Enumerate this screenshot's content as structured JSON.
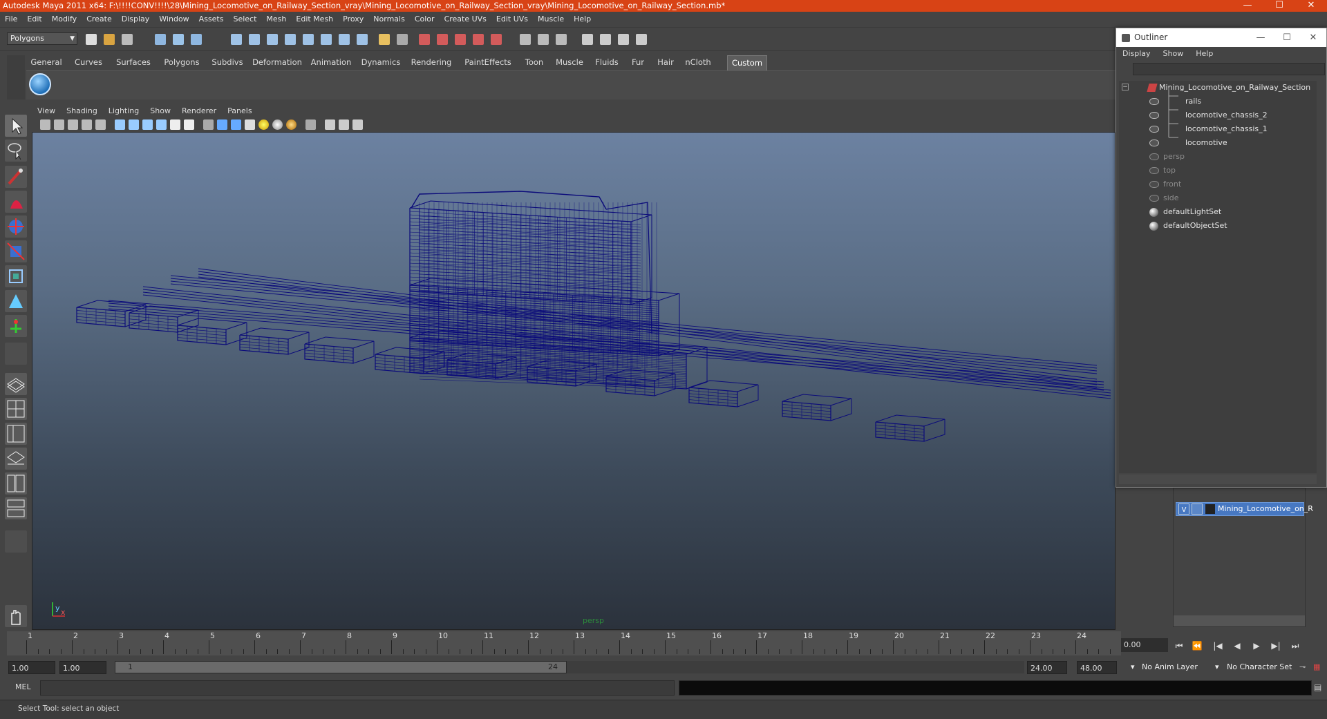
{
  "window": {
    "title": "Autodesk Maya 2011 x64: F:\\!!!!CONV!!!!\\28\\Mining_Locomotive_on_Railway_Section_vray\\Mining_Locomotive_on_Railway_Section_vray\\Mining_Locomotive_on_Railway_Section.mb*",
    "controls": [
      "—",
      "☐",
      "✕"
    ]
  },
  "menubar": [
    "File",
    "Edit",
    "Modify",
    "Create",
    "Display",
    "Window",
    "Assets",
    "Select",
    "Mesh",
    "Edit Mesh",
    "Proxy",
    "Normals",
    "Color",
    "Create UVs",
    "Edit UVs",
    "Muscle",
    "Help"
  ],
  "toolbar": {
    "mode": "Polygons"
  },
  "shelf": {
    "tabs": [
      "General",
      "Curves",
      "Surfaces",
      "Polygons",
      "Subdivs",
      "Deformation",
      "Animation",
      "Dynamics",
      "Rendering",
      "PaintEffects",
      "Toon",
      "Muscle",
      "Fluids",
      "Fur",
      "Hair",
      "nCloth",
      "Custom"
    ],
    "active": "Custom"
  },
  "panel": {
    "menu": [
      "View",
      "Shading",
      "Lighting",
      "Show",
      "Renderer",
      "Panels"
    ],
    "camera": "persp",
    "axis_y": "y",
    "axis_x": "x"
  },
  "timeline": {
    "ticks": [
      "1",
      "2",
      "3",
      "4",
      "5",
      "6",
      "7",
      "8",
      "9",
      "10",
      "11",
      "12",
      "13",
      "14",
      "15",
      "16",
      "17",
      "18",
      "19",
      "20",
      "21",
      "22",
      "23",
      "24"
    ],
    "current_time": "0.00",
    "playback_icons": [
      "⏮",
      "⏪",
      "|◀",
      "◀",
      "▶",
      "▶|",
      "⏭"
    ]
  },
  "range": {
    "start": "1.00",
    "start2": "1.00",
    "slider_start": "1",
    "slider_end": "24",
    "end": "24.00",
    "end2": "48.00",
    "anim_layer": "No Anim Layer",
    "char_set": "No Character Set"
  },
  "mel": {
    "label": "MEL"
  },
  "help": {
    "text": "Select Tool: select an object"
  },
  "outliner": {
    "title": "Outliner",
    "menu": [
      "Display",
      "Show",
      "Help"
    ],
    "items": [
      {
        "label": "Mining_Locomotive_on_Railway_Section",
        "dim": false
      },
      {
        "label": "rails",
        "dim": false
      },
      {
        "label": "locomotive_chassis_2",
        "dim": false
      },
      {
        "label": "locomotive_chassis_1",
        "dim": false
      },
      {
        "label": "locomotive",
        "dim": false
      },
      {
        "label": "persp",
        "dim": true
      },
      {
        "label": "top",
        "dim": true
      },
      {
        "label": "front",
        "dim": true
      },
      {
        "label": "side",
        "dim": true
      },
      {
        "label": "defaultLightSet",
        "dim": false
      },
      {
        "label": "defaultObjectSet",
        "dim": false
      }
    ]
  },
  "layers": {
    "visible": "V",
    "name": "Mining_Locomotive_on_R"
  },
  "colors": {
    "titlebar": "#d84315",
    "wireframe": "#0b0b7a",
    "layer_selected": "#4778c2"
  }
}
